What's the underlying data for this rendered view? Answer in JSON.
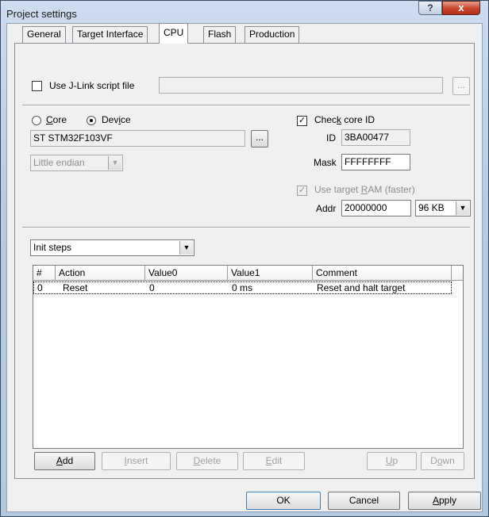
{
  "window": {
    "title": "Project settings",
    "help_label": "?",
    "close_label": "x"
  },
  "tabs": [
    {
      "label": "General"
    },
    {
      "label": "Target Interface"
    },
    {
      "label": "CPU"
    },
    {
      "label": "Flash"
    },
    {
      "label": "Production"
    }
  ],
  "script": {
    "checkbox_label": "Use J-Link script file",
    "path_value": "",
    "browse_label": "..."
  },
  "cpu": {
    "core_label_pre": "",
    "core_label_u": "C",
    "core_label_post": "ore",
    "device_label_pre": "Dev",
    "device_label_u": "i",
    "device_label_post": "ce",
    "device_value": "ST STM32F103VF",
    "device_browse": "...",
    "endian_value": "Little endian"
  },
  "core_id": {
    "check_label_pre": "Chec",
    "check_label_u": "k",
    "check_label_post": " core ID",
    "checked": "✓",
    "id_label": "ID",
    "id_value": "3BA00477",
    "mask_label": "Mask",
    "mask_value": "FFFFFFFF"
  },
  "ram": {
    "check_label_pre": "Use target ",
    "check_label_u": "R",
    "check_label_post": "AM (faster)",
    "checked": "✓",
    "addr_label": "Addr",
    "addr_value": "20000000",
    "size_value": "96 KB"
  },
  "steps": {
    "select_value": "Init steps",
    "columns": [
      "#",
      "Action",
      "Value0",
      "Value1",
      "Comment"
    ],
    "rows": [
      {
        "num": "0",
        "action": "Reset",
        "value0": "0",
        "value1": "0 ms",
        "comment": "Reset and halt target"
      }
    ]
  },
  "step_buttons": {
    "add_u": "A",
    "add_rest": "dd",
    "insert_u": "I",
    "insert_rest": "nsert",
    "delete_u": "D",
    "delete_rest": "elete",
    "edit_u": "E",
    "edit_rest": "dit",
    "up_u": "U",
    "up_rest": "p",
    "down_pre": "D",
    "down_u": "o",
    "down_rest": "wn"
  },
  "dialog_buttons": {
    "ok": "OK",
    "cancel": "Cancel",
    "apply_u": "A",
    "apply_rest": "pply"
  },
  "icons": {
    "dropdown": "▼",
    "check": "✓"
  }
}
